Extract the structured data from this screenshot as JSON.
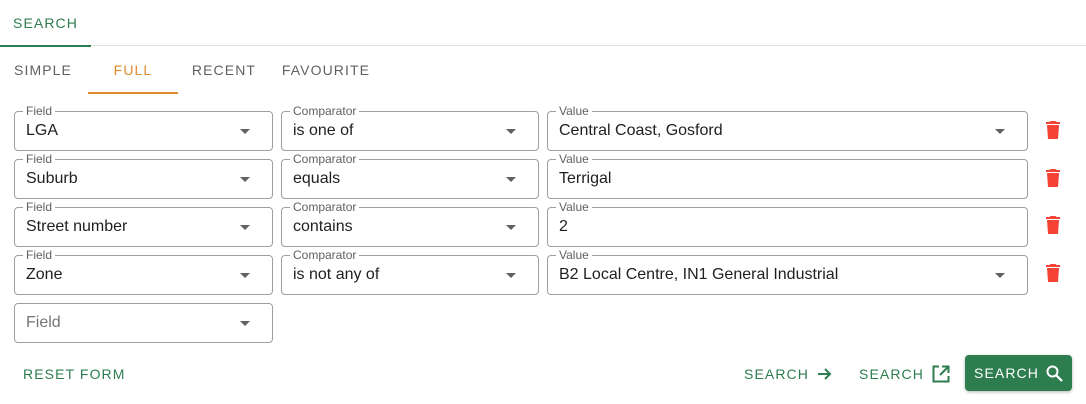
{
  "top_tabs": {
    "search": "SEARCH"
  },
  "sub_tabs": {
    "simple": "SIMPLE",
    "full": "FULL",
    "recent": "RECENT",
    "favourite": "FAVOURITE"
  },
  "labels": {
    "field": "Field",
    "comparator": "Comparator",
    "value": "Value"
  },
  "rows": [
    {
      "field": "LGA",
      "comparator": "is one of",
      "value": "Central Coast, Gosford"
    },
    {
      "field": "Suburb",
      "comparator": "equals",
      "value": "Terrigal"
    },
    {
      "field": "Street number",
      "comparator": "contains",
      "value": "2"
    },
    {
      "field": "Zone",
      "comparator": "is not any of",
      "value": "B2 Local Centre, IN1 General Industrial"
    }
  ],
  "new_row": {
    "placeholder": "Field"
  },
  "actions": {
    "reset": "RESET FORM",
    "search_here": "SEARCH",
    "search_new_tab": "SEARCH",
    "search_primary": "SEARCH"
  },
  "colors": {
    "primary": "#2e7d4f",
    "accent": "#e08a2e",
    "danger": "#f44336"
  }
}
